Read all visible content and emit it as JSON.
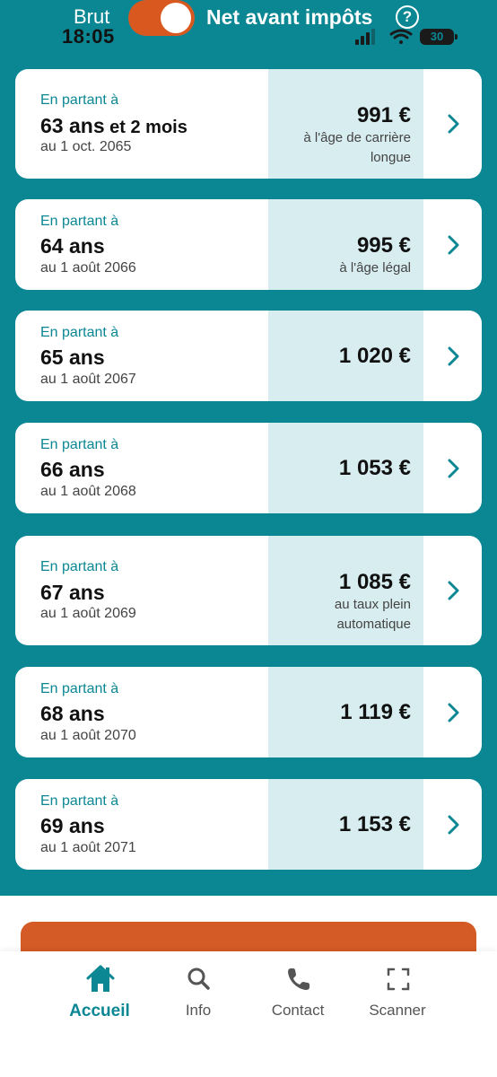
{
  "header": {
    "gross_label": "Brut",
    "time": "18:05",
    "net_label": "Net avant impôts",
    "help_glyph": "?",
    "battery_level": "30",
    "toggle_on": true
  },
  "colors": {
    "teal": "#0b8794",
    "orange": "#d9581f",
    "light_teal": "#d8edf0"
  },
  "cards": [
    {
      "prefix": "En partant à",
      "age": "63 ans",
      "age_extra": " et 2 mois",
      "date": "au 1 oct. 2065",
      "amount": "991 €",
      "note": "à l'âge de carrière longue"
    },
    {
      "prefix": "En partant à",
      "age": "64 ans",
      "age_extra": "",
      "date": "au 1 août 2066",
      "amount": "995 €",
      "note": "à l'âge légal"
    },
    {
      "prefix": "En partant à",
      "age": "65 ans",
      "age_extra": "",
      "date": "au 1 août 2067",
      "amount": "1 020 €",
      "note": ""
    },
    {
      "prefix": "En partant à",
      "age": "66 ans",
      "age_extra": "",
      "date": "au 1 août 2068",
      "amount": "1 053 €",
      "note": ""
    },
    {
      "prefix": "En partant à",
      "age": "67 ans",
      "age_extra": "",
      "date": "au 1 août 2069",
      "amount": "1 085 €",
      "note": "au taux plein automatique"
    },
    {
      "prefix": "En partant à",
      "age": "68 ans",
      "age_extra": "",
      "date": "au 1 août 2070",
      "amount": "1 119 €",
      "note": ""
    },
    {
      "prefix": "En partant à",
      "age": "69 ans",
      "age_extra": "",
      "date": "au 1 août 2071",
      "amount": "1 153 €",
      "note": ""
    }
  ],
  "tabs": [
    {
      "label": "Accueil",
      "icon": "home-icon",
      "active": true
    },
    {
      "label": "Info",
      "icon": "search-icon",
      "active": false
    },
    {
      "label": "Contact",
      "icon": "phone-icon",
      "active": false
    },
    {
      "label": "Scanner",
      "icon": "scan-icon",
      "active": false
    }
  ]
}
